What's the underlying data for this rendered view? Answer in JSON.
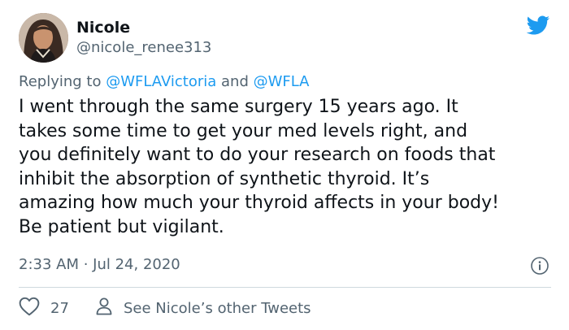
{
  "author": {
    "name": "Nicole",
    "handle": "@nicole_renee313"
  },
  "reply": {
    "prefix": "Replying to ",
    "mention1": "@WFLAVictoria",
    "joiner": " and ",
    "mention2": "@WFLA"
  },
  "body": {
    "lines": [
      "I went through the same surgery 15 years ago. It",
      "takes some time to get your med levels right, and",
      "you definitely want to do your research on foods that",
      "inhibit the absorption of synthetic thyroid. It’s",
      "amazing how much your thyroid affects in your body!",
      "Be patient but vigilant."
    ]
  },
  "meta": {
    "timestamp": "2:33 AM · Jul 24, 2020"
  },
  "actions": {
    "likes_count": "27",
    "other_tweets_label": "See Nicole’s other Tweets"
  },
  "icons": {
    "bird": "twitter-bird-icon",
    "info": "info-icon",
    "heart": "heart-icon",
    "person": "person-icon"
  },
  "colors": {
    "brand_blue": "#1d9bf0",
    "text_primary": "#0f1419",
    "text_secondary": "#536471",
    "divider": "#cfd9de"
  }
}
